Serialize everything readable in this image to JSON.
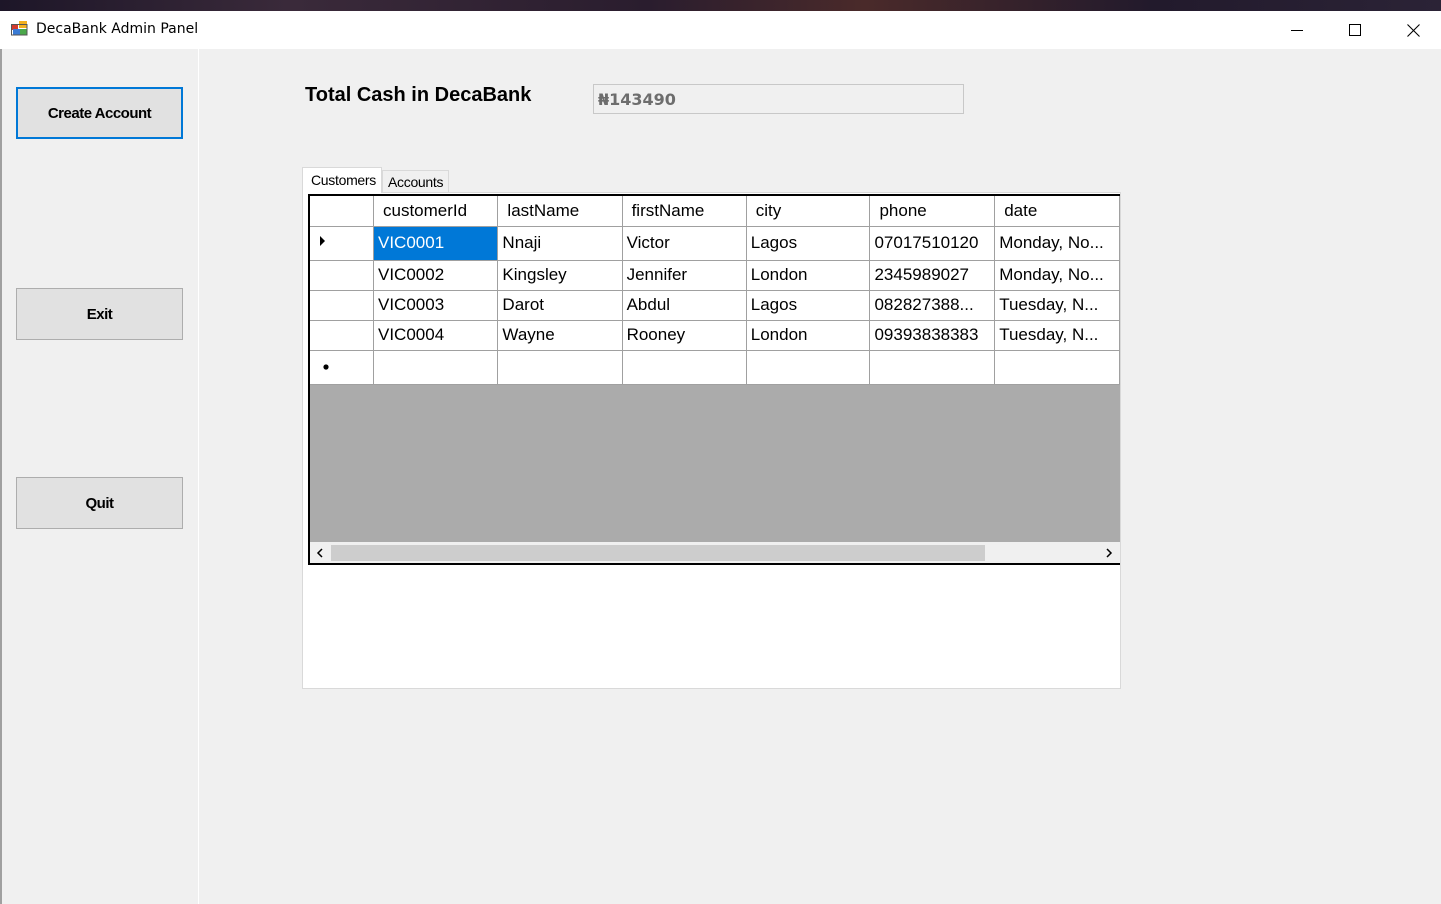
{
  "window": {
    "title": "DecaBank Admin Panel"
  },
  "sidebar": {
    "create_account_label": "Create Account",
    "exit_label": "Exit",
    "quit_label": "Quit"
  },
  "summary": {
    "total_cash_label": "Total Cash in DecaBank",
    "total_cash_value": "₦143490"
  },
  "tabs": [
    {
      "label": "Customers",
      "active": true
    },
    {
      "label": "Accounts",
      "active": false
    }
  ],
  "customers_grid": {
    "columns": [
      "customerId",
      "lastName",
      "firstName",
      "city",
      "phone",
      "date"
    ],
    "rows": [
      [
        "VIC0001",
        "Nnaji",
        "Victor",
        "Lagos",
        "07017510120",
        "Monday, No..."
      ],
      [
        "VIC0002",
        "Kingsley",
        "Jennifer",
        "London",
        "2345989027",
        "Monday, No..."
      ],
      [
        "VIC0003",
        "Darot",
        "Abdul",
        "Lagos",
        "082827388...",
        "Tuesday, N..."
      ],
      [
        "VIC0004",
        "Wayne",
        "Rooney",
        "London",
        "09393838383",
        "Tuesday, N..."
      ]
    ],
    "selected_cell": "VIC0001",
    "current_row_marker": "triangle-right-icon",
    "new_row_marker": "asterisk-icon"
  },
  "colors": {
    "selection": "#0078d7",
    "grid_background": "#ababab",
    "window_background": "#f0f0f0"
  }
}
